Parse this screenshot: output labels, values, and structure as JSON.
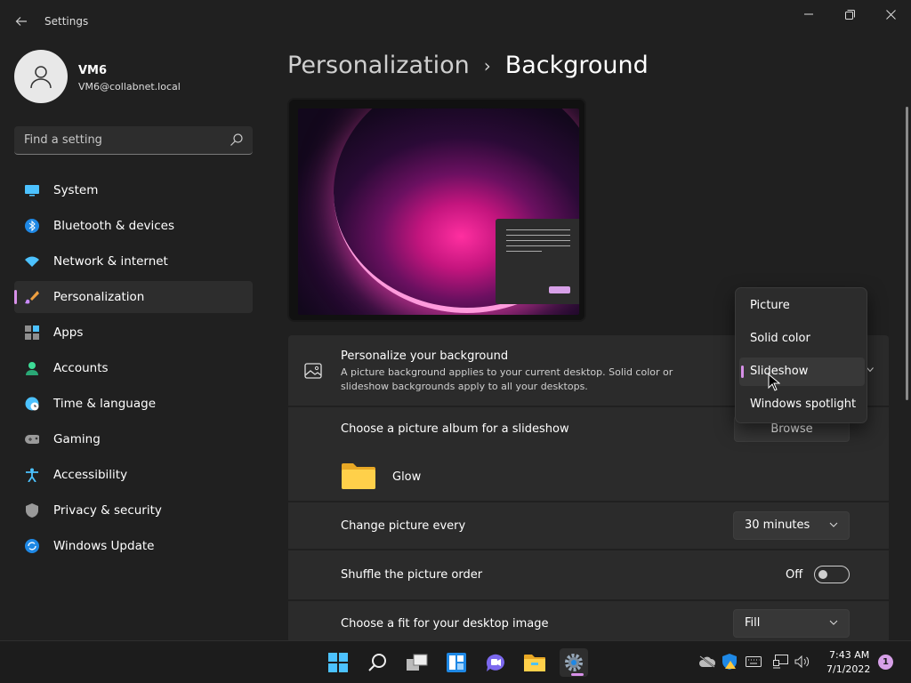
{
  "window": {
    "title": "Settings"
  },
  "profile": {
    "name": "VM6",
    "email": "VM6@collabnet.local"
  },
  "search": {
    "placeholder": "Find a setting"
  },
  "sidebar": {
    "items": [
      {
        "label": "System",
        "icon": "monitor-icon"
      },
      {
        "label": "Bluetooth & devices",
        "icon": "bluetooth-icon"
      },
      {
        "label": "Network & internet",
        "icon": "wifi-icon"
      },
      {
        "label": "Personalization",
        "icon": "brush-icon",
        "active": true
      },
      {
        "label": "Apps",
        "icon": "apps-icon"
      },
      {
        "label": "Accounts",
        "icon": "person-icon"
      },
      {
        "label": "Time & language",
        "icon": "globe-clock-icon"
      },
      {
        "label": "Gaming",
        "icon": "gamepad-icon"
      },
      {
        "label": "Accessibility",
        "icon": "accessibility-icon"
      },
      {
        "label": "Privacy & security",
        "icon": "shield-icon"
      },
      {
        "label": "Windows Update",
        "icon": "update-icon"
      }
    ]
  },
  "breadcrumb": {
    "parent": "Personalization",
    "current": "Background"
  },
  "settings": {
    "personalize": {
      "title": "Personalize your background",
      "desc": "A picture background applies to your current desktop. Solid color or slideshow backgrounds apply to all your desktops."
    },
    "album": {
      "title": "Choose a picture album for a slideshow",
      "button": "Browse",
      "folder": "Glow"
    },
    "interval": {
      "title": "Change picture every",
      "value": "30 minutes"
    },
    "shuffle": {
      "title": "Shuffle the picture order",
      "state": "Off"
    },
    "fit": {
      "title": "Choose a fit for your desktop image",
      "value": "Fill"
    }
  },
  "flyout": {
    "options": [
      "Picture",
      "Solid color",
      "Slideshow",
      "Windows spotlight"
    ],
    "selected": "Slideshow"
  },
  "taskbar": {
    "apps": [
      "start-icon",
      "search-icon",
      "task-view-icon",
      "widgets-icon",
      "chat-icon",
      "file-explorer-icon",
      "settings-icon"
    ],
    "time": "7:43 AM",
    "date": "7/1/2022",
    "notifications": "1"
  },
  "colors": {
    "accent": "#d790e8",
    "background": "#202020",
    "card": "#2b2b2b"
  }
}
